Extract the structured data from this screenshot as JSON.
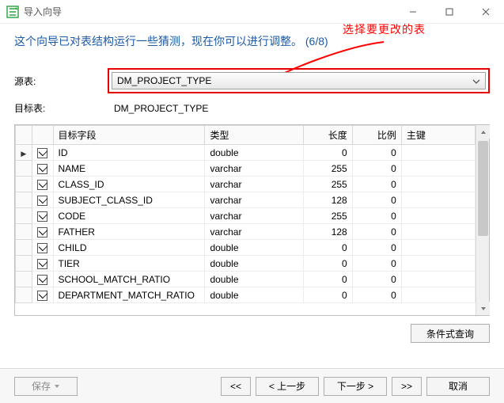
{
  "window": {
    "title": "导入向导"
  },
  "headline": "这个向导已对表结构运行一些猜测，现在你可以进行调整。 (6/8)",
  "annotation": "选择要更改的表",
  "labels": {
    "source": "源表:",
    "target": "目标表:"
  },
  "source_value": "DM_PROJECT_TYPE",
  "target_value": "DM_PROJECT_TYPE",
  "columns": {
    "field": "目标字段",
    "type": "类型",
    "length": "长度",
    "scale": "比例",
    "pk": "主键"
  },
  "rows": [
    {
      "checked": true,
      "current": true,
      "field": "ID",
      "type": "double",
      "length": 0,
      "scale": 0
    },
    {
      "checked": true,
      "current": false,
      "field": "NAME",
      "type": "varchar",
      "length": 255,
      "scale": 0
    },
    {
      "checked": true,
      "current": false,
      "field": "CLASS_ID",
      "type": "varchar",
      "length": 255,
      "scale": 0
    },
    {
      "checked": true,
      "current": false,
      "field": "SUBJECT_CLASS_ID",
      "type": "varchar",
      "length": 128,
      "scale": 0
    },
    {
      "checked": true,
      "current": false,
      "field": "CODE",
      "type": "varchar",
      "length": 255,
      "scale": 0
    },
    {
      "checked": true,
      "current": false,
      "field": "FATHER",
      "type": "varchar",
      "length": 128,
      "scale": 0
    },
    {
      "checked": true,
      "current": false,
      "field": "CHILD",
      "type": "double",
      "length": 0,
      "scale": 0
    },
    {
      "checked": true,
      "current": false,
      "field": "TIER",
      "type": "double",
      "length": 0,
      "scale": 0
    },
    {
      "checked": true,
      "current": false,
      "field": "SCHOOL_MATCH_RATIO",
      "type": "double",
      "length": 0,
      "scale": 0
    },
    {
      "checked": true,
      "current": false,
      "field": "DEPARTMENT_MATCH_RATIO",
      "type": "double",
      "length": 0,
      "scale": 0
    }
  ],
  "buttons": {
    "query": "条件式查询",
    "save": "保存",
    "first": "<<",
    "back": "< 上一步",
    "next": "下一步 >",
    "last": ">>",
    "cancel": "取消"
  }
}
